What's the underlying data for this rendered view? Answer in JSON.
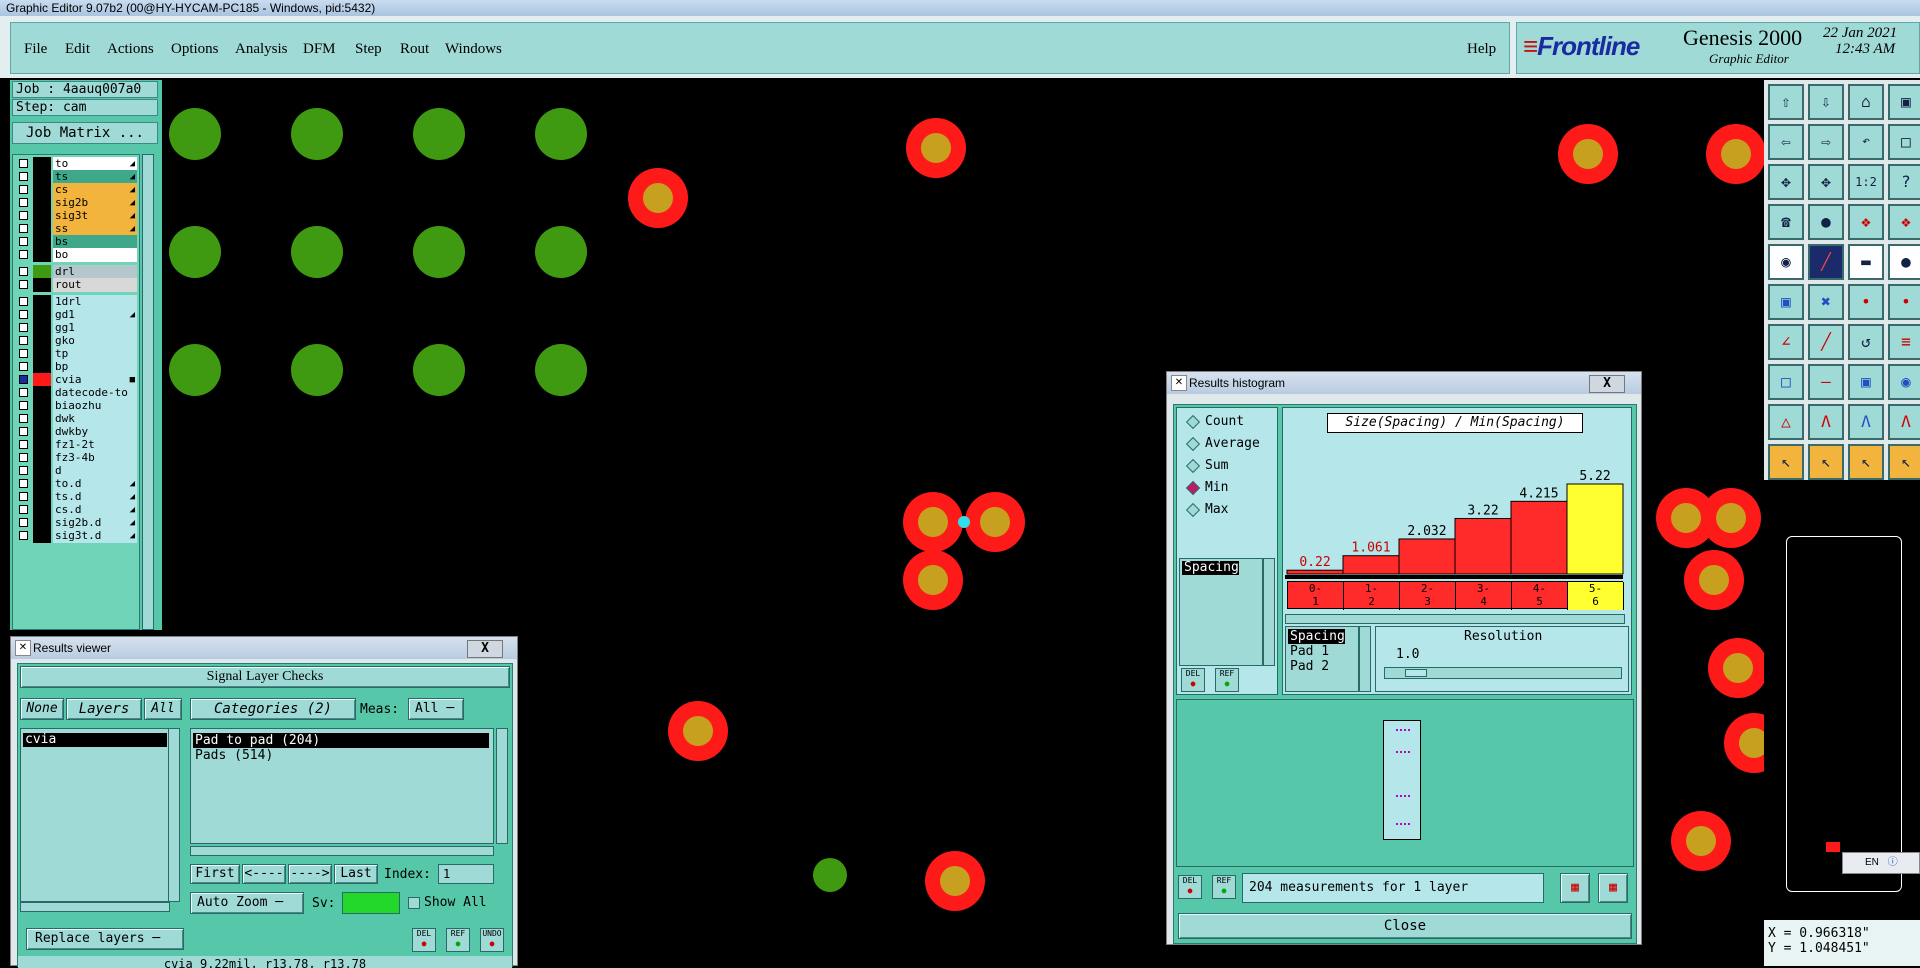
{
  "window": {
    "title": "Graphic Editor 9.07b2 (00@HY-HYCAM-PC185 - Windows, pid:5432)"
  },
  "menu": {
    "file": "File",
    "edit": "Edit",
    "actions": "Actions",
    "options": "Options",
    "analysis": "Analysis",
    "dfm": "DFM",
    "step": "Step",
    "rout": "Rout",
    "windows": "Windows",
    "help": "Help"
  },
  "brand": {
    "logo": "Frontline",
    "product": "Genesis 2000",
    "subtitle": "Graphic Editor",
    "date": "22 Jan 2021",
    "time": "12:43 AM"
  },
  "left": {
    "job": "Job : 4aauq007a0",
    "step": "Step: cam",
    "job_matrix": "Job Matrix ..."
  },
  "layers": [
    {
      "name": "to",
      "color": "#ffffff",
      "swatch": "#000000",
      "flag": "◢"
    },
    {
      "name": "ts",
      "color": "#3fa88a",
      "swatch": "#000000",
      "flag": "◢"
    },
    {
      "name": "cs",
      "color": "#f2b43c",
      "swatch": "#000000",
      "flag": "◢"
    },
    {
      "name": "sig2b",
      "color": "#f2b43c",
      "swatch": "#000000",
      "flag": "◢"
    },
    {
      "name": "sig3t",
      "color": "#f2b43c",
      "swatch": "#000000",
      "flag": "◢"
    },
    {
      "name": "ss",
      "color": "#f2b43c",
      "swatch": "#000000",
      "flag": "◢"
    },
    {
      "name": "bs",
      "color": "#3fa88a",
      "swatch": "#000000",
      "flag": ""
    },
    {
      "name": "bo",
      "color": "#ffffff",
      "swatch": "#000000",
      "flag": ""
    },
    {
      "name": "drl",
      "color": "#b4c8cc",
      "swatch": "#3f9a12",
      "flag": ""
    },
    {
      "name": "rout",
      "color": "#d8d8d8",
      "swatch": "#000000",
      "flag": ""
    },
    {
      "name": "1drl",
      "color": "#b4e6ea",
      "swatch": "#000000",
      "flag": ""
    },
    {
      "name": "gd1",
      "color": "#b4e6ea",
      "swatch": "#000000",
      "flag": "◢"
    },
    {
      "name": "gg1",
      "color": "#b4e6ea",
      "swatch": "#000000",
      "flag": ""
    },
    {
      "name": "gko",
      "color": "#b4e6ea",
      "swatch": "#000000",
      "flag": ""
    },
    {
      "name": "tp",
      "color": "#b4e6ea",
      "swatch": "#000000",
      "flag": ""
    },
    {
      "name": "bp",
      "color": "#b4e6ea",
      "swatch": "#000000",
      "flag": ""
    },
    {
      "name": "cvia",
      "color": "#b4e6ea",
      "swatch": "#ff1a1a",
      "flag": "■"
    },
    {
      "name": "datecode-to",
      "color": "#b4e6ea",
      "swatch": "#000000",
      "flag": ""
    },
    {
      "name": "biaozhu",
      "color": "#b4e6ea",
      "swatch": "#000000",
      "flag": ""
    },
    {
      "name": "dwk",
      "color": "#b4e6ea",
      "swatch": "#000000",
      "flag": ""
    },
    {
      "name": "dwkby",
      "color": "#b4e6ea",
      "swatch": "#000000",
      "flag": ""
    },
    {
      "name": "fz1-2t",
      "color": "#b4e6ea",
      "swatch": "#000000",
      "flag": ""
    },
    {
      "name": "fz3-4b",
      "color": "#b4e6ea",
      "swatch": "#000000",
      "flag": ""
    },
    {
      "name": "d",
      "color": "#b4e6ea",
      "swatch": "#000000",
      "flag": ""
    },
    {
      "name": "to.d",
      "color": "#b4e6ea",
      "swatch": "#000000",
      "flag": "◢"
    },
    {
      "name": "ts.d",
      "color": "#b4e6ea",
      "swatch": "#000000",
      "flag": "◢"
    },
    {
      "name": "cs.d",
      "color": "#b4e6ea",
      "swatch": "#000000",
      "flag": "◢"
    },
    {
      "name": "sig2b.d",
      "color": "#b4e6ea",
      "swatch": "#000000",
      "flag": "◢"
    },
    {
      "name": "sig3t.d",
      "color": "#b4e6ea",
      "swatch": "#000000",
      "flag": "◢"
    }
  ],
  "results_viewer": {
    "title": "Results viewer",
    "close": "X",
    "heading": "Signal Layer Checks",
    "none": "None",
    "layers": "Layers",
    "all": "All",
    "categories": "Categories (2)",
    "meas_label": "Meas:",
    "meas_value": "All",
    "layer_items": [
      "cvia"
    ],
    "category_items": [
      "Pad to pad (204)",
      "Pads (514)"
    ],
    "first": "First",
    "prev": "<----",
    "next": "---->",
    "last": "Last",
    "index_label": "Index:",
    "index_value": "1",
    "auto_zoom": "Auto Zoom",
    "sv_label": "Sv:",
    "show_all": "Show All",
    "replace_layers": "Replace layers",
    "del": "DEL",
    "ref": "REF",
    "undo": "UNDO",
    "status": "cvia 9.22mil, r13.78, r13.78"
  },
  "histogram": {
    "title": "Results histogram",
    "close": "X",
    "modes": [
      "Count",
      "Average",
      "Sum",
      "Min",
      "Max"
    ],
    "selected_mode": "Min",
    "type_items": [
      "Spacing"
    ],
    "heading": "Size(Spacing) / Min(Spacing)",
    "resolution_label": "Resolution",
    "resolution_value": "1.0",
    "size_items": [
      "Spacing",
      "Pad 1",
      "Pad 2"
    ],
    "status": "204 measurements for 1 layer",
    "close_button": "Close",
    "del": "DEL",
    "ref": "REF"
  },
  "coords": {
    "x": "X = 0.966318\"",
    "y": "Y = 1.048451\""
  },
  "lang": {
    "label": "EN"
  },
  "chart_data": {
    "type": "bar",
    "title": "Size(Spacing) / Min(Spacing)",
    "categories": [
      "0-1",
      "1-2",
      "2-3",
      "3-4",
      "4-5",
      "5-6"
    ],
    "values": [
      0.22,
      1.061,
      2.032,
      3.22,
      4.215,
      5.22
    ],
    "value_labels": [
      "0.22",
      "1.061",
      "2.032",
      "3.22",
      "4.215",
      "5.22"
    ],
    "ylim": [
      0,
      5.22
    ],
    "colors": {
      "bar": "#ff2a2a",
      "highlight": "#ffff30",
      "label_low": "#cc0000"
    }
  }
}
